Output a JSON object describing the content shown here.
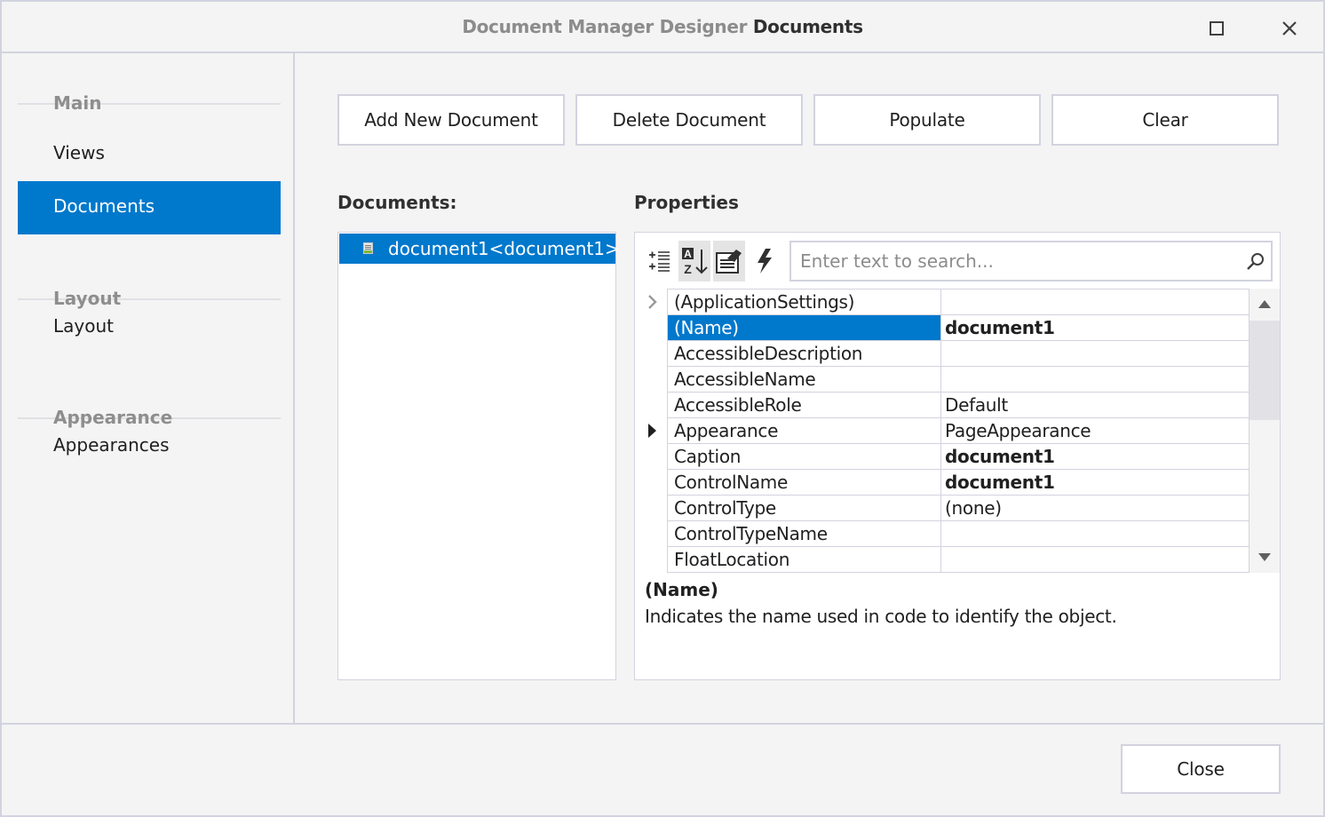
{
  "window": {
    "title_prefix": "Document Manager Designer",
    "title_section": "Documents",
    "maximize_label": "Maximize",
    "close_label": "Close window"
  },
  "sidebar": {
    "groups": [
      {
        "label": "Main",
        "items": [
          {
            "label": "Views",
            "active": false
          },
          {
            "label": "Documents",
            "active": true
          }
        ]
      },
      {
        "label": "Layout",
        "items": [
          {
            "label": "Layout",
            "active": false
          }
        ]
      },
      {
        "label": "Appearance",
        "items": [
          {
            "label": "Appearances",
            "active": false
          }
        ]
      }
    ]
  },
  "toolbar": {
    "add_label": "Add New Document",
    "delete_label": "Delete Document",
    "populate_label": "Populate",
    "clear_label": "Clear"
  },
  "documents": {
    "label": "Documents:",
    "items": [
      {
        "label": "document1<document1>",
        "selected": true
      }
    ]
  },
  "properties": {
    "label": "Properties",
    "tools": [
      {
        "icon": "categorized-icon",
        "pressed": false
      },
      {
        "icon": "sort-alphabetical-icon",
        "pressed": true
      },
      {
        "icon": "properties-icon",
        "pressed": true
      },
      {
        "icon": "events-lightning-icon",
        "pressed": false
      }
    ],
    "search_placeholder": "Enter text to search...",
    "search_value": "",
    "rows": [
      {
        "name": "(ApplicationSettings)",
        "value": "",
        "bold": false,
        "expander": "collapsed-light",
        "selected": false
      },
      {
        "name": "(Name)",
        "value": "document1",
        "bold": true,
        "expander": "",
        "selected": true
      },
      {
        "name": "AccessibleDescription",
        "value": "",
        "bold": false,
        "expander": "",
        "selected": false
      },
      {
        "name": "AccessibleName",
        "value": "",
        "bold": false,
        "expander": "",
        "selected": false
      },
      {
        "name": "AccessibleRole",
        "value": "Default",
        "bold": false,
        "expander": "",
        "selected": false
      },
      {
        "name": "Appearance",
        "value": "PageAppearance",
        "bold": false,
        "expander": "collapsed-dark",
        "selected": false
      },
      {
        "name": "Caption",
        "value": "document1",
        "bold": true,
        "expander": "",
        "selected": false
      },
      {
        "name": "ControlName",
        "value": "document1",
        "bold": true,
        "expander": "",
        "selected": false
      },
      {
        "name": "ControlType",
        "value": "(none)",
        "bold": false,
        "expander": "",
        "selected": false
      },
      {
        "name": "ControlTypeName",
        "value": "",
        "bold": false,
        "expander": "",
        "selected": false
      },
      {
        "name": "FloatLocation",
        "value": "",
        "bold": false,
        "expander": "",
        "selected": false
      }
    ],
    "description_title": "(Name)",
    "description_text": "Indicates the name used in code to identify the object."
  },
  "footer": {
    "close_label": "Close"
  }
}
